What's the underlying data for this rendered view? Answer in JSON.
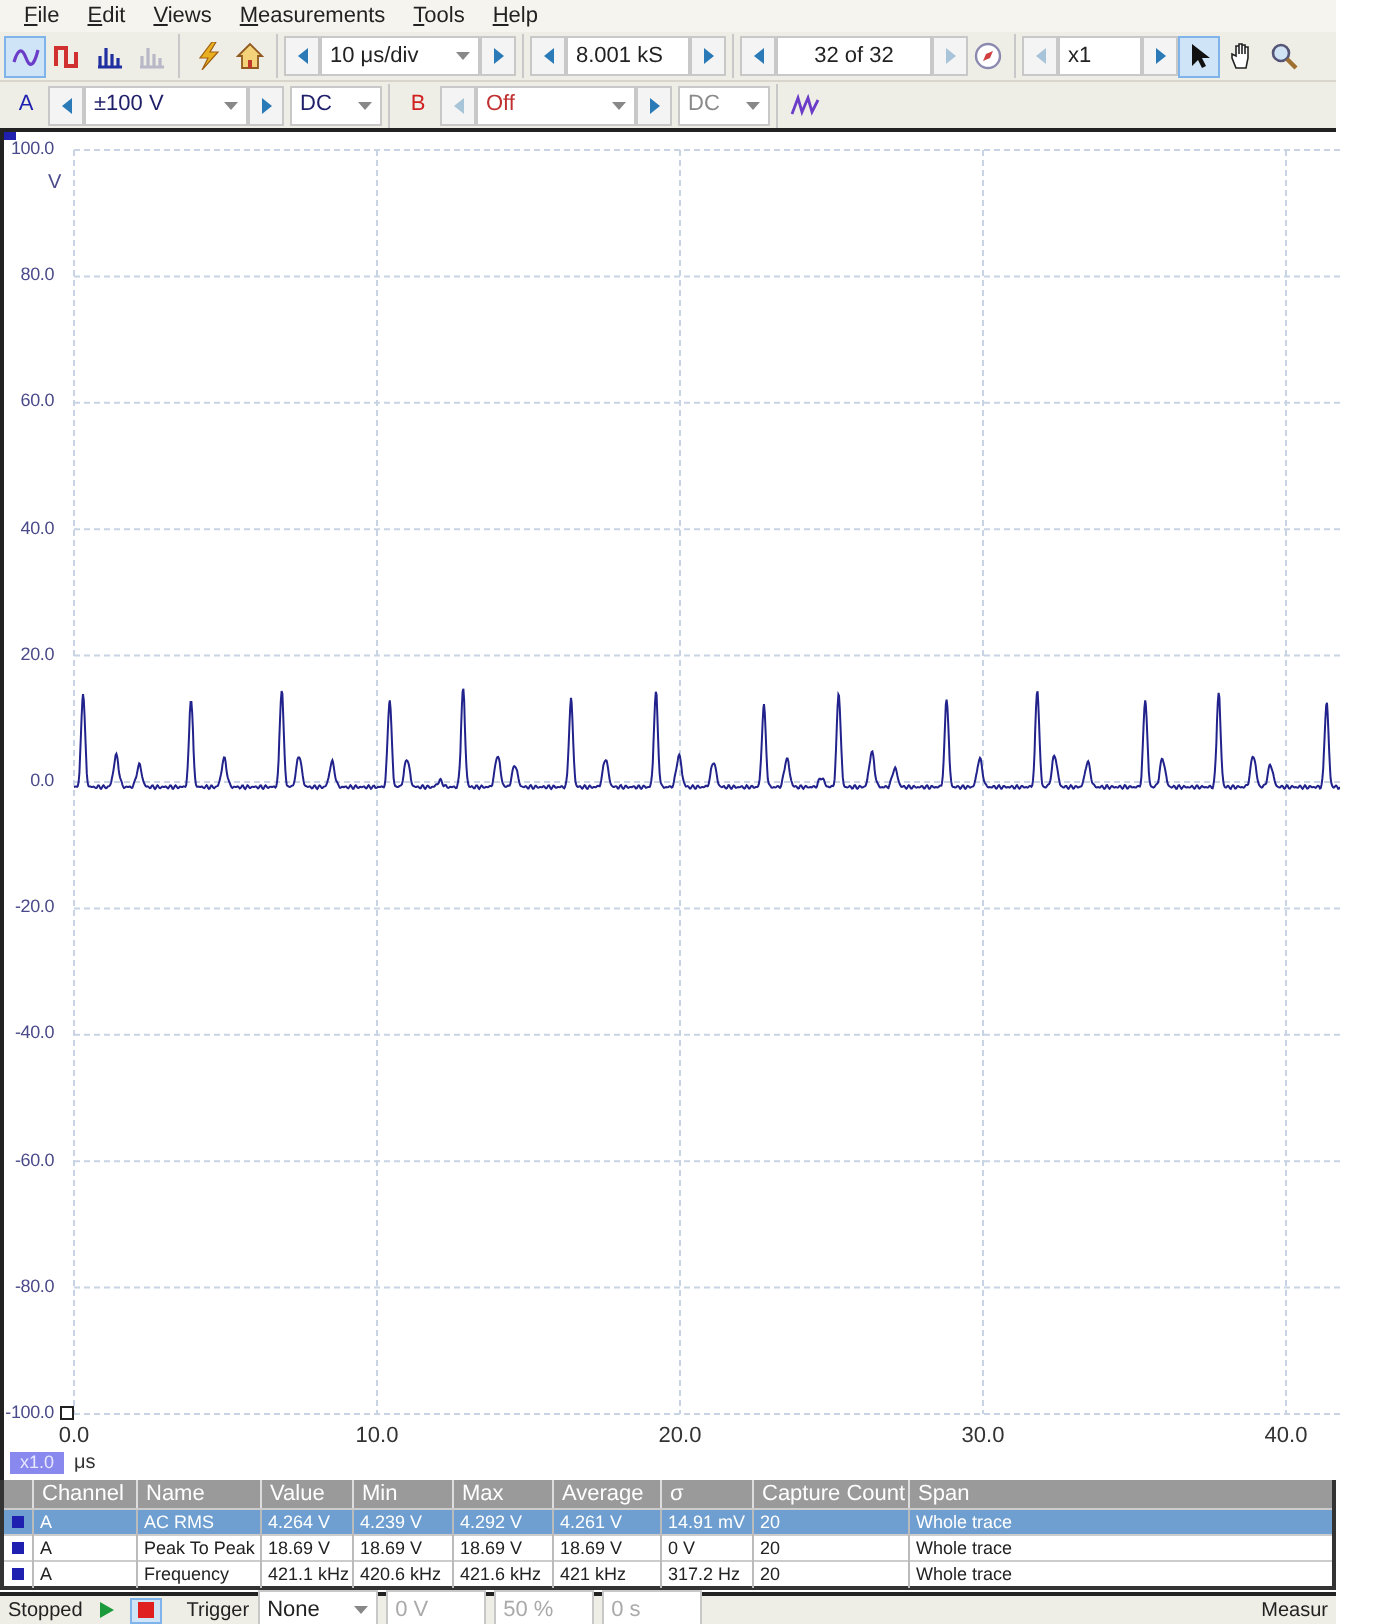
{
  "menu": [
    {
      "label": "File"
    },
    {
      "label": "Edit"
    },
    {
      "label": "Views"
    },
    {
      "label": "Measurements"
    },
    {
      "label": "Tools"
    },
    {
      "label": "Help"
    }
  ],
  "toolbar": {
    "view_modes": [
      {
        "kind": "scope",
        "selected": true
      },
      {
        "kind": "persistence",
        "selected": false
      },
      {
        "kind": "spectrum",
        "selected": false
      },
      {
        "kind": "spectrum-disabled",
        "selected": false
      }
    ],
    "timebase": "10 μs/div",
    "samples": "8.001 kS",
    "buffer": "32 of 32",
    "zoom": "x1",
    "tools": [
      {
        "kind": "pointer",
        "selected": true
      },
      {
        "kind": "hand",
        "selected": false
      },
      {
        "kind": "zoom",
        "selected": false
      }
    ]
  },
  "channels": [
    {
      "label": "A",
      "range": "±100 V",
      "coupling": "DC",
      "enabled": true,
      "color": "#1f1fb0"
    },
    {
      "label": "B",
      "range": "Off",
      "coupling": "DC",
      "enabled": false,
      "color": "#d02020"
    }
  ],
  "plot": {
    "unit": "V",
    "y_labels": [
      "100.0",
      "80.0",
      "60.0",
      "40.0",
      "20.0",
      "0.0",
      "-20.0",
      "-40.0",
      "-60.0",
      "-80.0",
      "-100.0"
    ],
    "x_labels": [
      "0.0",
      "10.0",
      "20.0",
      "30.0",
      "40.0"
    ],
    "zoom_factor": "x1.0",
    "x_unit": "μs"
  },
  "table": {
    "columns": [
      "Channel",
      "Name",
      "Value",
      "Min",
      "Max",
      "Average",
      "σ",
      "Capture Count",
      "Span"
    ],
    "rows": [
      {
        "selected": true,
        "color": "#1f1fb0",
        "cells": [
          "A",
          "AC RMS",
          "4.264 V",
          "4.239 V",
          "4.292 V",
          "4.261 V",
          "14.91 mV",
          "20",
          "Whole trace"
        ]
      },
      {
        "selected": false,
        "color": "#1f1fb0",
        "cells": [
          "A",
          "Peak To Peak",
          "18.69 V",
          "18.69 V",
          "18.69 V",
          "18.69 V",
          "0 V",
          "20",
          "Whole trace"
        ]
      },
      {
        "selected": false,
        "color": "#1f1fb0",
        "cells": [
          "A",
          "Frequency",
          "421.1 kHz",
          "420.6 kHz",
          "421.6 kHz",
          "421 kHz",
          "317.2 Hz",
          "20",
          "Whole trace"
        ]
      }
    ]
  },
  "status_bar": {
    "state": "Stopped",
    "running": false,
    "trigger_label": "Trigger",
    "trigger_mode": "None",
    "threshold": "0 V",
    "pretrigger": "50 %",
    "delay": "0 s",
    "measurements_label": "Measur"
  }
}
